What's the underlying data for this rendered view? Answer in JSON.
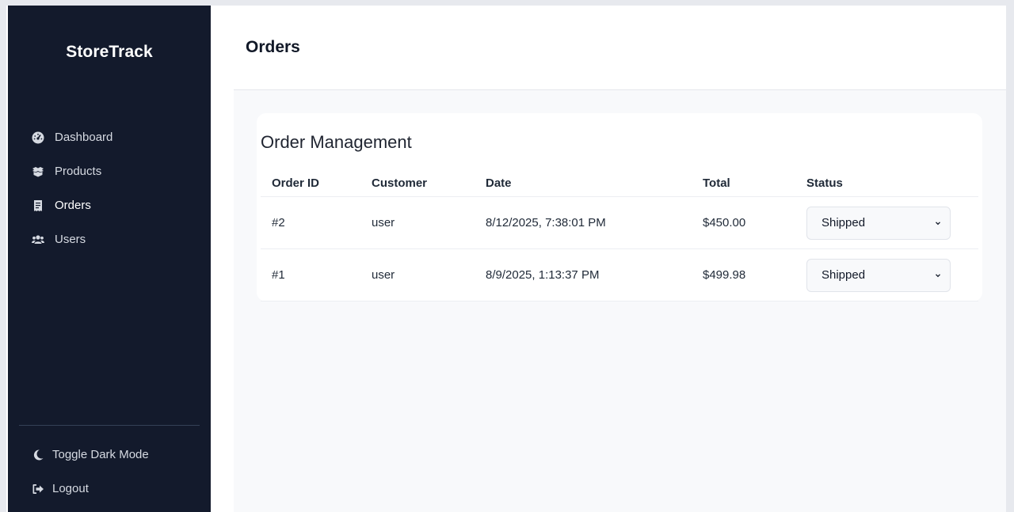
{
  "app": {
    "brand": "StoreTrack"
  },
  "sidebar": {
    "items": [
      {
        "label": "Dashboard",
        "icon": "dashboard-icon"
      },
      {
        "label": "Products",
        "icon": "boxes-icon"
      },
      {
        "label": "Orders",
        "icon": "receipt-icon",
        "active": true
      },
      {
        "label": "Users",
        "icon": "users-icon"
      }
    ],
    "bottom": [
      {
        "label": "Toggle Dark Mode",
        "icon": "moon-icon"
      },
      {
        "label": "Logout",
        "icon": "logout-icon"
      }
    ]
  },
  "header": {
    "title": "Orders"
  },
  "orders": {
    "title": "Order Management",
    "columns": [
      "Order ID",
      "Customer",
      "Date",
      "Total",
      "Status"
    ],
    "rows": [
      {
        "id": "#2",
        "customer": "user",
        "date": "8/12/2025, 7:38:01 PM",
        "total": "$450.00",
        "status": "Shipped"
      },
      {
        "id": "#1",
        "customer": "user",
        "date": "8/9/2025, 1:13:37 PM",
        "total": "$499.98",
        "status": "Shipped"
      }
    ]
  },
  "colors": {
    "sidebar_bg": "#131a2c",
    "main_bg": "#f8f9fb",
    "card_bg": "#ffffff"
  }
}
